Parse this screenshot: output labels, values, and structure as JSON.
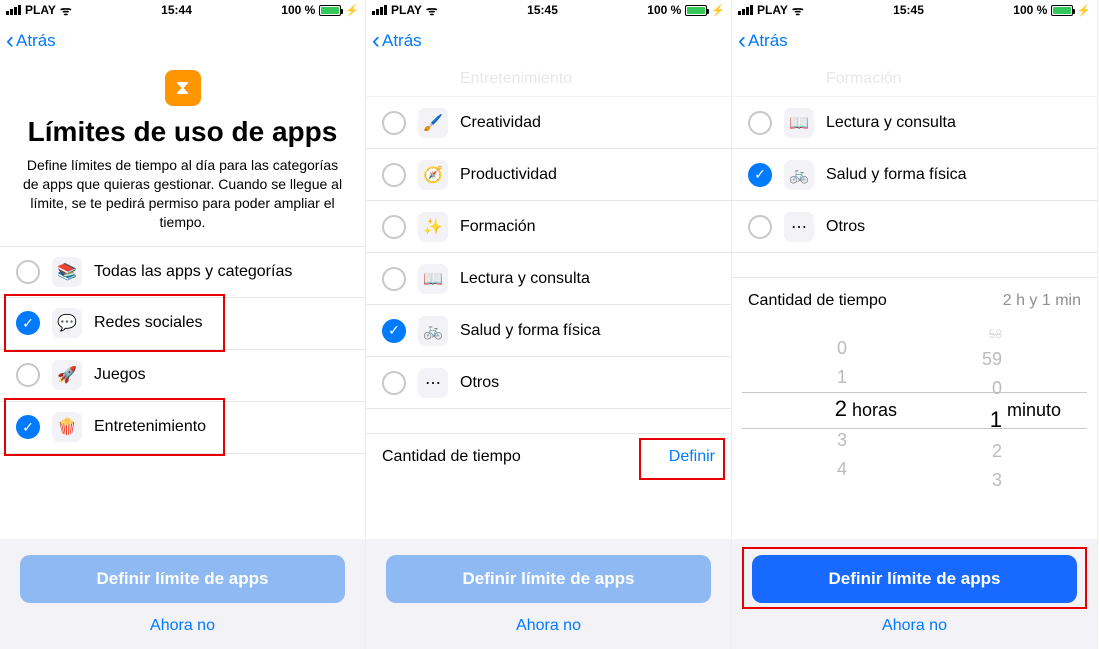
{
  "status": {
    "carrier": "PLAY",
    "battery_text": "100 %"
  },
  "times": {
    "s1": "15:44",
    "s2": "15:45",
    "s3": "15:45"
  },
  "nav": {
    "back": "Atrás"
  },
  "hero": {
    "title": "Límites de uso de apps",
    "desc": "Define límites de tiempo al día para las categorías de apps que quieras gestionar. Cuando se llegue al límite, se te pedirá permiso para poder ampliar el tiempo."
  },
  "cats": {
    "all": "Todas las apps y categorías",
    "social": "Redes sociales",
    "games": "Juegos",
    "entertainment": "Entretenimiento",
    "creativity": "Creatividad",
    "productivity": "Productividad",
    "education": "Formación",
    "reading": "Lectura y consulta",
    "health": "Salud y forma física",
    "other": "Otros"
  },
  "time_section": {
    "label": "Cantidad de tiempo",
    "define": "Definir",
    "value": "2 h y 1 min"
  },
  "footer": {
    "primary": "Definir límite de apps",
    "secondary": "Ahora no"
  },
  "chart_data": {
    "type": "table",
    "title": "Time picker selection",
    "hours_unit": "horas",
    "minutes_unit": "minuto",
    "hours_options_visible": [
      0,
      1,
      2,
      3,
      4
    ],
    "minutes_options_visible": [
      58,
      59,
      0,
      1,
      2,
      3
    ],
    "selected": {
      "hours": 2,
      "minutes": 1
    }
  }
}
